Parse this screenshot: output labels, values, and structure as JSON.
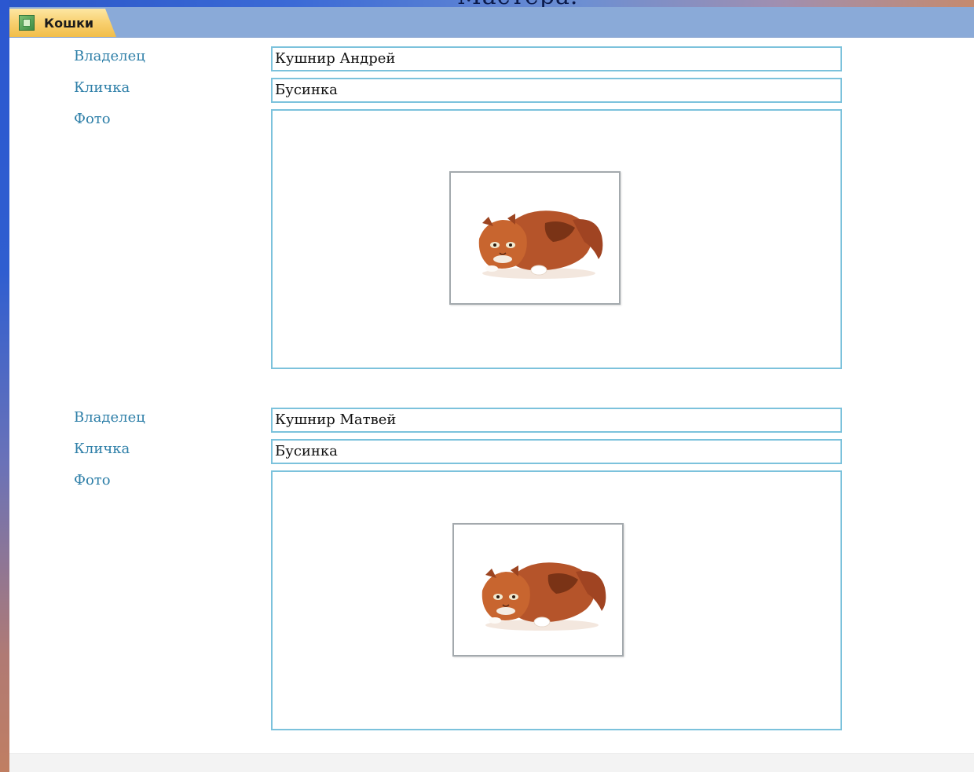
{
  "slide": {
    "title_fragment": "Мастера."
  },
  "tab": {
    "label": "Кошки",
    "icon": "form-icon"
  },
  "records": [
    {
      "owner_label": "Владелец",
      "owner_value": "Кушнир Андрей",
      "nickname_label": "Кличка",
      "nickname_value": "Бусинка",
      "photo_label": "Фото",
      "photo_icon": "cat-photo"
    },
    {
      "owner_label": "Владелец",
      "owner_value": "Кушнир Матвей",
      "nickname_label": "Кличка",
      "nickname_value": "Бусинка",
      "photo_label": "Фото",
      "photo_icon": "cat-photo"
    }
  ],
  "colors": {
    "label": "#2e7fa8",
    "field_border": "#7cc2dc",
    "tabbar": "#8aaad8",
    "tab": "#f8d06f"
  }
}
